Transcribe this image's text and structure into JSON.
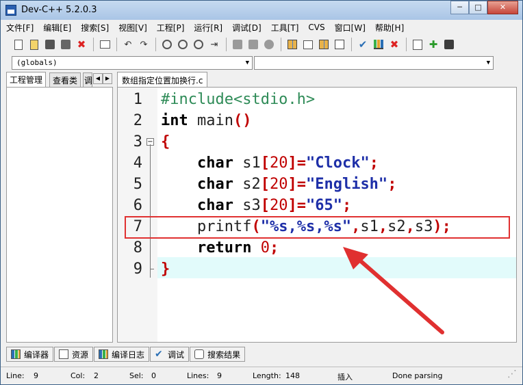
{
  "window": {
    "title": "Dev-C++ 5.2.0.3",
    "controls": [
      "─",
      "□",
      "✕"
    ]
  },
  "menu": [
    "文件[F]",
    "编辑[E]",
    "搜索[S]",
    "视图[V]",
    "工程[P]",
    "运行[R]",
    "调试[D]",
    "工具[T]",
    "CVS",
    "窗口[W]",
    "帮助[H]"
  ],
  "toolbar_icons": [
    "new-file-icon",
    "open-icon",
    "save-icon",
    "save-all-icon",
    "close-file-icon",
    "print-icon",
    "undo-icon",
    "redo-icon",
    "find-icon",
    "replace-icon",
    "find-next-icon",
    "goto-line-icon",
    "bookmark-icon",
    "toggle-bookmark-icon",
    "indent-icon",
    "new-project-icon",
    "class-icon",
    "project-options-icon",
    "layout-icon",
    "compile-icon",
    "run-icon",
    "compile-run-icon",
    "rebuild-icon",
    "debug-icon",
    "stop-icon"
  ],
  "dropdowns": {
    "class": "(globals)",
    "member": ""
  },
  "left_tabs": [
    "工程管理",
    "查看类",
    "调"
  ],
  "file_tab": "数组指定位置加换行.c",
  "code_lines": [
    {
      "n": "1",
      "text": "#include<stdio.h>"
    },
    {
      "n": "2",
      "text": "int main()"
    },
    {
      "n": "3",
      "text": "{"
    },
    {
      "n": "4",
      "text": "    char s1[20]=\"Clock\";"
    },
    {
      "n": "5",
      "text": "    char s2[20]=\"English\";"
    },
    {
      "n": "6",
      "text": "    char s3[20]=\"65\";"
    },
    {
      "n": "7",
      "text": "    printf(\"%s,%s,%s\",s1,s2,s3);"
    },
    {
      "n": "8",
      "text": "    return 0;"
    },
    {
      "n": "9",
      "text": "}"
    }
  ],
  "bottom_tabs": [
    "编译器",
    "资源",
    "编译日志",
    "调试",
    "搜索结果"
  ],
  "status": {
    "line_label": "Line:",
    "line_value": "9",
    "col_label": "Col:",
    "col_value": "2",
    "sel_label": "Sel:",
    "sel_value": "0",
    "lines_label": "Lines:",
    "lines_value": "9",
    "length_label": "Length:",
    "length_value": "148",
    "mode": "插入",
    "parse": "Done parsing"
  },
  "colors": {
    "keyword": "#000000",
    "preprocessor": "#2e8b57",
    "string": "#1e2fa8",
    "symbol": "#c00000",
    "active_line": "#e2fbfb",
    "annotation": "#e03030"
  }
}
